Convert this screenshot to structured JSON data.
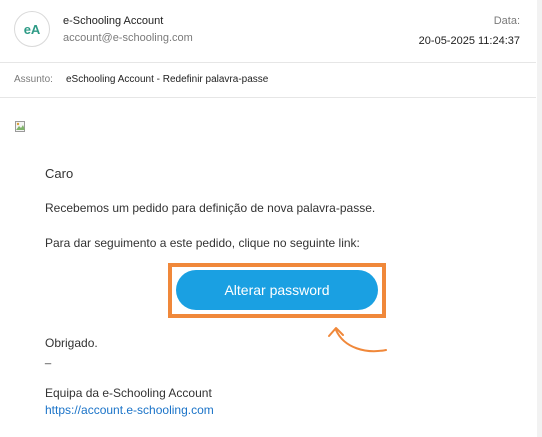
{
  "header": {
    "avatar_initials": "eA",
    "sender_name": "e-Schooling Account",
    "sender_email": "account@e-schooling.com",
    "date_label": "Data:",
    "date_value": "20-05-2025 11:24:37"
  },
  "subject": {
    "label": "Assunto:",
    "value": "eSchooling Account - Redefinir palavra-passe"
  },
  "body": {
    "broken_image_icon": "broken-image-icon",
    "greeting": "Caro",
    "line1": "Recebemos um pedido para definição de nova palavra-passe.",
    "line2": "Para dar seguimento a este pedido, clique no seguinte link:",
    "button_label": "Alterar password",
    "thanks": "Obrigado.",
    "signature_dash": "_",
    "team": "Equipa da e-Schooling Account",
    "link_text": "https://account.e-schooling.com"
  },
  "colors": {
    "accent_button": "#1aa0e2",
    "highlight_orange": "#f0883a",
    "link_blue": "#1a73c8",
    "avatar_text": "#2e9b86"
  }
}
